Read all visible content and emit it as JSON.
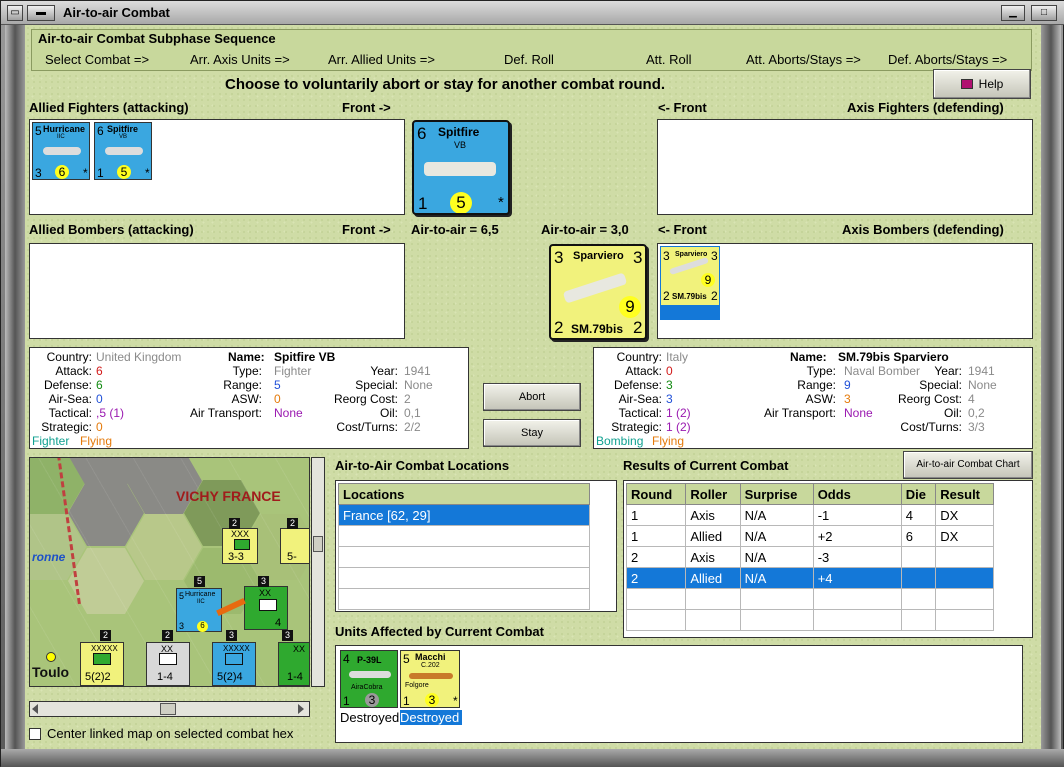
{
  "window": {
    "title": "Air-to-air Combat"
  },
  "sequence": {
    "title": "Air-to-air Combat Subphase Sequence",
    "steps": [
      "Select Combat =>",
      "Arr. Axis Units =>",
      "Arr. Allied Units =>",
      "Def. Roll",
      "Att. Roll",
      "Att. Aborts/Stays =>",
      "Def. Aborts/Stays =>"
    ]
  },
  "prompt": "Choose to voluntarily abort or stay for another combat round.",
  "help_label": "Help",
  "labels": {
    "allied_fighters": "Allied Fighters (attacking)",
    "front_right": "Front ->",
    "front_left": "<- Front",
    "axis_fighters": "Axis Fighters (defending)",
    "allied_bombers": "Allied Bombers (attacking)",
    "axis_bombers": "Axis Bombers (defending)",
    "a2a_allied": "Air-to-air = 6,5",
    "a2a_axis": "Air-to-air = 3,0"
  },
  "allied_fighters": [
    {
      "name": "Hurricane",
      "sub": "IIC",
      "tl": "5",
      "bl": "3",
      "dot": "6",
      "br": "*"
    },
    {
      "name": "Spitfire",
      "sub": "VB",
      "tl": "6",
      "bl": "1",
      "dot": "5",
      "br": "*"
    }
  ],
  "big_allied": {
    "name": "Spitfire",
    "sub": "VB",
    "tl": "6",
    "bl": "1",
    "dot": "5",
    "br": "*"
  },
  "big_axis": {
    "name": "Sparviero",
    "model": "SM.79bis",
    "tl": "3",
    "tr": "3",
    "bl": "2",
    "br": "2",
    "dot": "9"
  },
  "axis_bomber_small": {
    "name": "Sparviero",
    "model": "SM.79bis",
    "tl": "3",
    "tr": "3",
    "bl": "2",
    "br": "2",
    "dot": "9"
  },
  "allied_info": {
    "keys": [
      "Country:",
      "Attack:",
      "Defense:",
      "Air-Sea:",
      "Tactical:",
      "Strategic:"
    ],
    "vals": [
      "United Kingdom",
      "6",
      "6",
      "0",
      ",5 (1)",
      "0"
    ],
    "bottom1": "Fighter",
    "bottom2": "Flying",
    "name_key": "Name:",
    "name_val": "Spitfire VB",
    "mid_keys": [
      "Type:",
      "Range:",
      "ASW:",
      "Air Transport:"
    ],
    "mid_vals": [
      "Fighter",
      "5",
      "0",
      "None"
    ],
    "r_keys": [
      "Year:",
      "Special:",
      "Reorg Cost:",
      "Oil:",
      "Cost/Turns:"
    ],
    "r_vals": [
      "1941",
      "None",
      "2",
      "0,1",
      "2/2"
    ]
  },
  "axis_info": {
    "keys": [
      "Country:",
      "Attack:",
      "Defense:",
      "Air-Sea:",
      "Tactical:",
      "Strategic:"
    ],
    "vals": [
      "Italy",
      "0",
      "3",
      "3",
      "1 (2)",
      "1 (2)"
    ],
    "bottom1": "Bombing",
    "bottom2": "Flying",
    "name_key": "Name:",
    "name_val": "SM.79bis Sparviero",
    "mid_keys": [
      "Type:",
      "Range:",
      "ASW:",
      "Air Transport:"
    ],
    "mid_vals": [
      "Naval Bomber",
      "9",
      "3",
      "None"
    ],
    "r_keys": [
      "Year:",
      "Special:",
      "Reorg Cost:",
      "Oil:",
      "Cost/Turns:"
    ],
    "r_vals": [
      "1941",
      "None",
      "4",
      "0,2",
      "3/3"
    ]
  },
  "buttons": {
    "abort": "Abort",
    "stay": "Stay",
    "chart": "Air-to-air Combat Chart"
  },
  "locations": {
    "title": "Air-to-Air Combat Locations",
    "header": "Locations",
    "rows": [
      "France [62, 29]"
    ]
  },
  "results": {
    "title": "Results of Current Combat",
    "headers": [
      "Round",
      "Roller",
      "Surprise",
      "Odds",
      "Die",
      "Result"
    ],
    "rows": [
      [
        "1",
        "Axis",
        "N/A",
        "-1",
        "4",
        "DX"
      ],
      [
        "1",
        "Allied",
        "N/A",
        "+2",
        "6",
        "DX"
      ],
      [
        "2",
        "Axis",
        "N/A",
        "-3",
        "",
        ""
      ],
      [
        "2",
        "Allied",
        "N/A",
        "+4",
        "",
        ""
      ]
    ]
  },
  "affected": {
    "title": "Units Affected by Current Combat",
    "units": [
      {
        "name": "P-39L",
        "sub": "AiraCobra",
        "tl": "4",
        "bl": "1",
        "dot": "3",
        "status": "Destroyed"
      },
      {
        "name": "Macchi",
        "sub": "C.202",
        "extra": "Folgore",
        "tl": "5",
        "bl": "1",
        "dot": "3",
        "br": "*",
        "status": "Destroyed"
      }
    ]
  },
  "map": {
    "region": "VICHY FRANCE",
    "river": "ronne",
    "city": "Toulo",
    "counters": [
      {
        "top": "XXX",
        "label": "3-3",
        "side": "Bayliss",
        "corner": "2"
      },
      {
        "top": "XX",
        "label": "4",
        "corner": "3"
      },
      {
        "top": "XXXXX",
        "label": "5(2)2",
        "corner": "2"
      },
      {
        "top": "XX",
        "label": "1-4",
        "corner": "2"
      },
      {
        "top": "XXXXX",
        "label": "5(2)4",
        "corner": "3"
      },
      {
        "top": "XX",
        "label": "1-4",
        "corner": "3"
      },
      {
        "top": "XX",
        "label": "5-",
        "corner": "2"
      },
      {
        "label": "1-4",
        "corner": "3"
      }
    ],
    "hurricane": {
      "name": "Hurricane",
      "sub": "IIC",
      "tl": "5",
      "bl": "3",
      "dot": "6"
    },
    "corner5": "5"
  },
  "center_map_label": "Center linked map on selected combat hex",
  "colors": {
    "panel_bg": "#cfdca6",
    "selection": "#1478d8",
    "allied_counter": "#3aa7e0",
    "axis_counter": "#f1f27c",
    "soviet_counter": "#2fa92f"
  }
}
